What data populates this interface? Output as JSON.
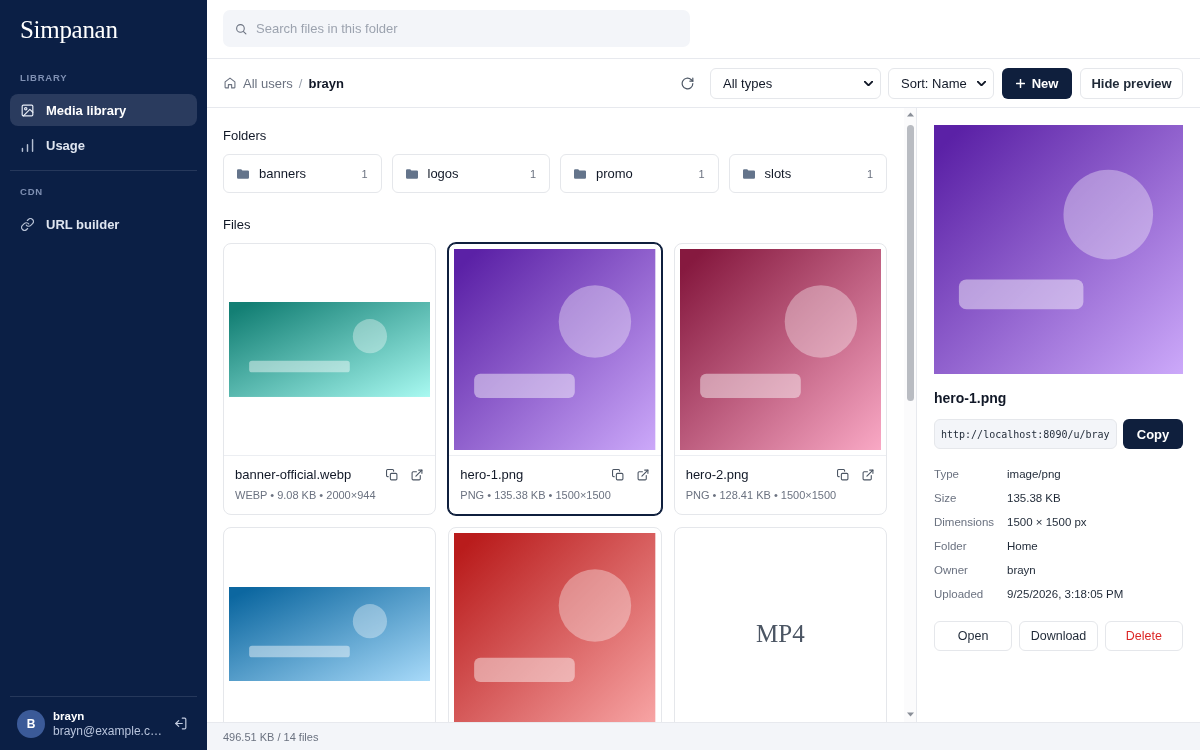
{
  "sidebar": {
    "logo": "Simpanan",
    "sections": [
      {
        "label": "LIBRARY",
        "items": [
          {
            "label": "Media library",
            "selected": true
          },
          {
            "label": "Usage",
            "selected": false
          }
        ]
      },
      {
        "label": "CDN",
        "items": [
          {
            "label": "URL builder",
            "selected": false
          }
        ]
      }
    ],
    "user": {
      "initial": "B",
      "name": "brayn",
      "email": "brayn@example.c…"
    }
  },
  "search": {
    "placeholder": "Search files in this folder"
  },
  "toolbar": {
    "breadcrumb": [
      {
        "label": "All users",
        "current": false
      },
      {
        "label": "brayn",
        "current": true
      }
    ],
    "separator": "/",
    "type_filter": "All types",
    "sort": "Sort: Name",
    "new_button": "New",
    "preview_toggle": "Hide preview"
  },
  "folders_heading": "Folders",
  "folders": [
    {
      "name": "banners",
      "count": "1"
    },
    {
      "name": "logos",
      "count": "1"
    },
    {
      "name": "promo",
      "count": "1"
    },
    {
      "name": "slots",
      "count": "1"
    }
  ],
  "files_heading": "Files",
  "files": [
    {
      "kind": "banner",
      "color": "#137f74",
      "name": "banner-official.webp",
      "meta": "WEBP • 9.08 KB • 2000×944",
      "selected": false
    },
    {
      "kind": "square",
      "color": "#5b21a6",
      "name": "hero-1.png",
      "meta": "PNG • 135.38 KB • 1500×1500",
      "selected": true
    },
    {
      "kind": "square",
      "color": "#86193f",
      "name": "hero-2.png",
      "meta": "PNG • 128.41 KB • 1500×1500",
      "selected": false
    },
    {
      "kind": "banner",
      "color": "#0c67a0",
      "selected": false
    },
    {
      "kind": "square",
      "color": "#b91c1c",
      "selected": false
    },
    {
      "kind": "video",
      "label": "MP4",
      "selected": false
    }
  ],
  "preview": {
    "color": "#5b21a6",
    "name": "hero-1.png",
    "url": "http://localhost:8090/u/bray",
    "copy_button": "Copy",
    "details": [
      {
        "label": "Type",
        "value": "image/png"
      },
      {
        "label": "Size",
        "value": "135.38 KB"
      },
      {
        "label": "Dimensions",
        "value": "1500 × 1500 px"
      },
      {
        "label": "Folder",
        "value": "Home"
      },
      {
        "label": "Owner",
        "value": "brayn"
      },
      {
        "label": "Uploaded",
        "value": "9/25/2026, 3:18:05 PM"
      }
    ],
    "actions": [
      {
        "label": "Open",
        "kind": "default"
      },
      {
        "label": "Download",
        "kind": "default"
      },
      {
        "label": "Delete",
        "kind": "danger"
      }
    ]
  },
  "status_bar": {
    "text": "496.51 KB / 14 files"
  }
}
